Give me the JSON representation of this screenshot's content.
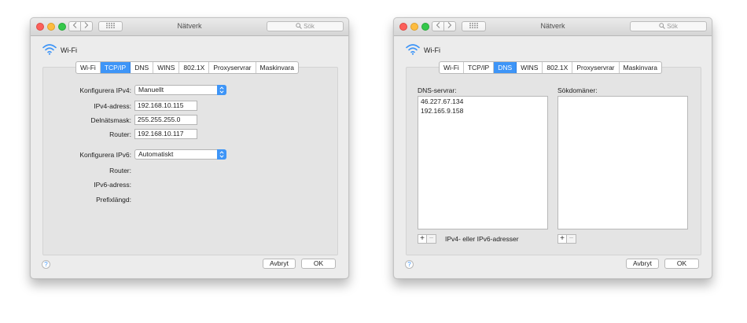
{
  "windows": [
    {
      "title": "Nätverk",
      "search_placeholder": "Sök",
      "interface_name": "Wi-Fi",
      "tabs": [
        {
          "label": "Wi-Fi",
          "active": false
        },
        {
          "label": "TCP/IP",
          "active": true
        },
        {
          "label": "DNS",
          "active": false
        },
        {
          "label": "WINS",
          "active": false
        },
        {
          "label": "802.1X",
          "active": false
        },
        {
          "label": "Proxyservrar",
          "active": false
        },
        {
          "label": "Maskinvara",
          "active": false
        }
      ],
      "tcpip": {
        "ipv4_config_label": "Konfigurera IPv4:",
        "ipv4_config_value": "Manuellt",
        "ipv4_address_label": "IPv4-adress:",
        "ipv4_address_value": "192.168.10.115",
        "subnet_label": "Delnätsmask:",
        "subnet_value": "255.255.255.0",
        "router_label": "Router:",
        "router_value": "192.168.10.117",
        "ipv6_config_label": "Konfigurera IPv6:",
        "ipv6_config_value": "Automatiskt",
        "ipv6_router_label": "Router:",
        "ipv6_address_label": "IPv6-adress:",
        "prefix_label": "Prefixlängd:"
      },
      "buttons": {
        "help": "?",
        "cancel": "Avbryt",
        "ok": "OK"
      }
    },
    {
      "title": "Nätverk",
      "search_placeholder": "Sök",
      "interface_name": "Wi-Fi",
      "tabs": [
        {
          "label": "Wi-Fi",
          "active": false
        },
        {
          "label": "TCP/IP",
          "active": false
        },
        {
          "label": "DNS",
          "active": true
        },
        {
          "label": "WINS",
          "active": false
        },
        {
          "label": "802.1X",
          "active": false
        },
        {
          "label": "Proxyservrar",
          "active": false
        },
        {
          "label": "Maskinvara",
          "active": false
        }
      ],
      "dns": {
        "servers_label": "DNS-servrar:",
        "servers": [
          "46.227.67.134",
          "192.165.9.158"
        ],
        "search_domains_label": "Sökdomäner:",
        "search_domains": [],
        "add_symbol": "+",
        "remove_symbol": "−",
        "hint": "IPv4- eller IPv6-adresser"
      },
      "buttons": {
        "help": "?",
        "cancel": "Avbryt",
        "ok": "OK"
      }
    }
  ],
  "colors": {
    "accent": "#3e95f7",
    "close": "#fc605b",
    "minimize": "#fdbc40",
    "maximize": "#34c84a",
    "window_bg": "#ececec"
  },
  "icons": [
    "wifi-icon",
    "search-icon",
    "chevron-left-icon",
    "chevron-right-icon",
    "grid-icon",
    "popup-arrows-icon",
    "help-icon"
  ]
}
